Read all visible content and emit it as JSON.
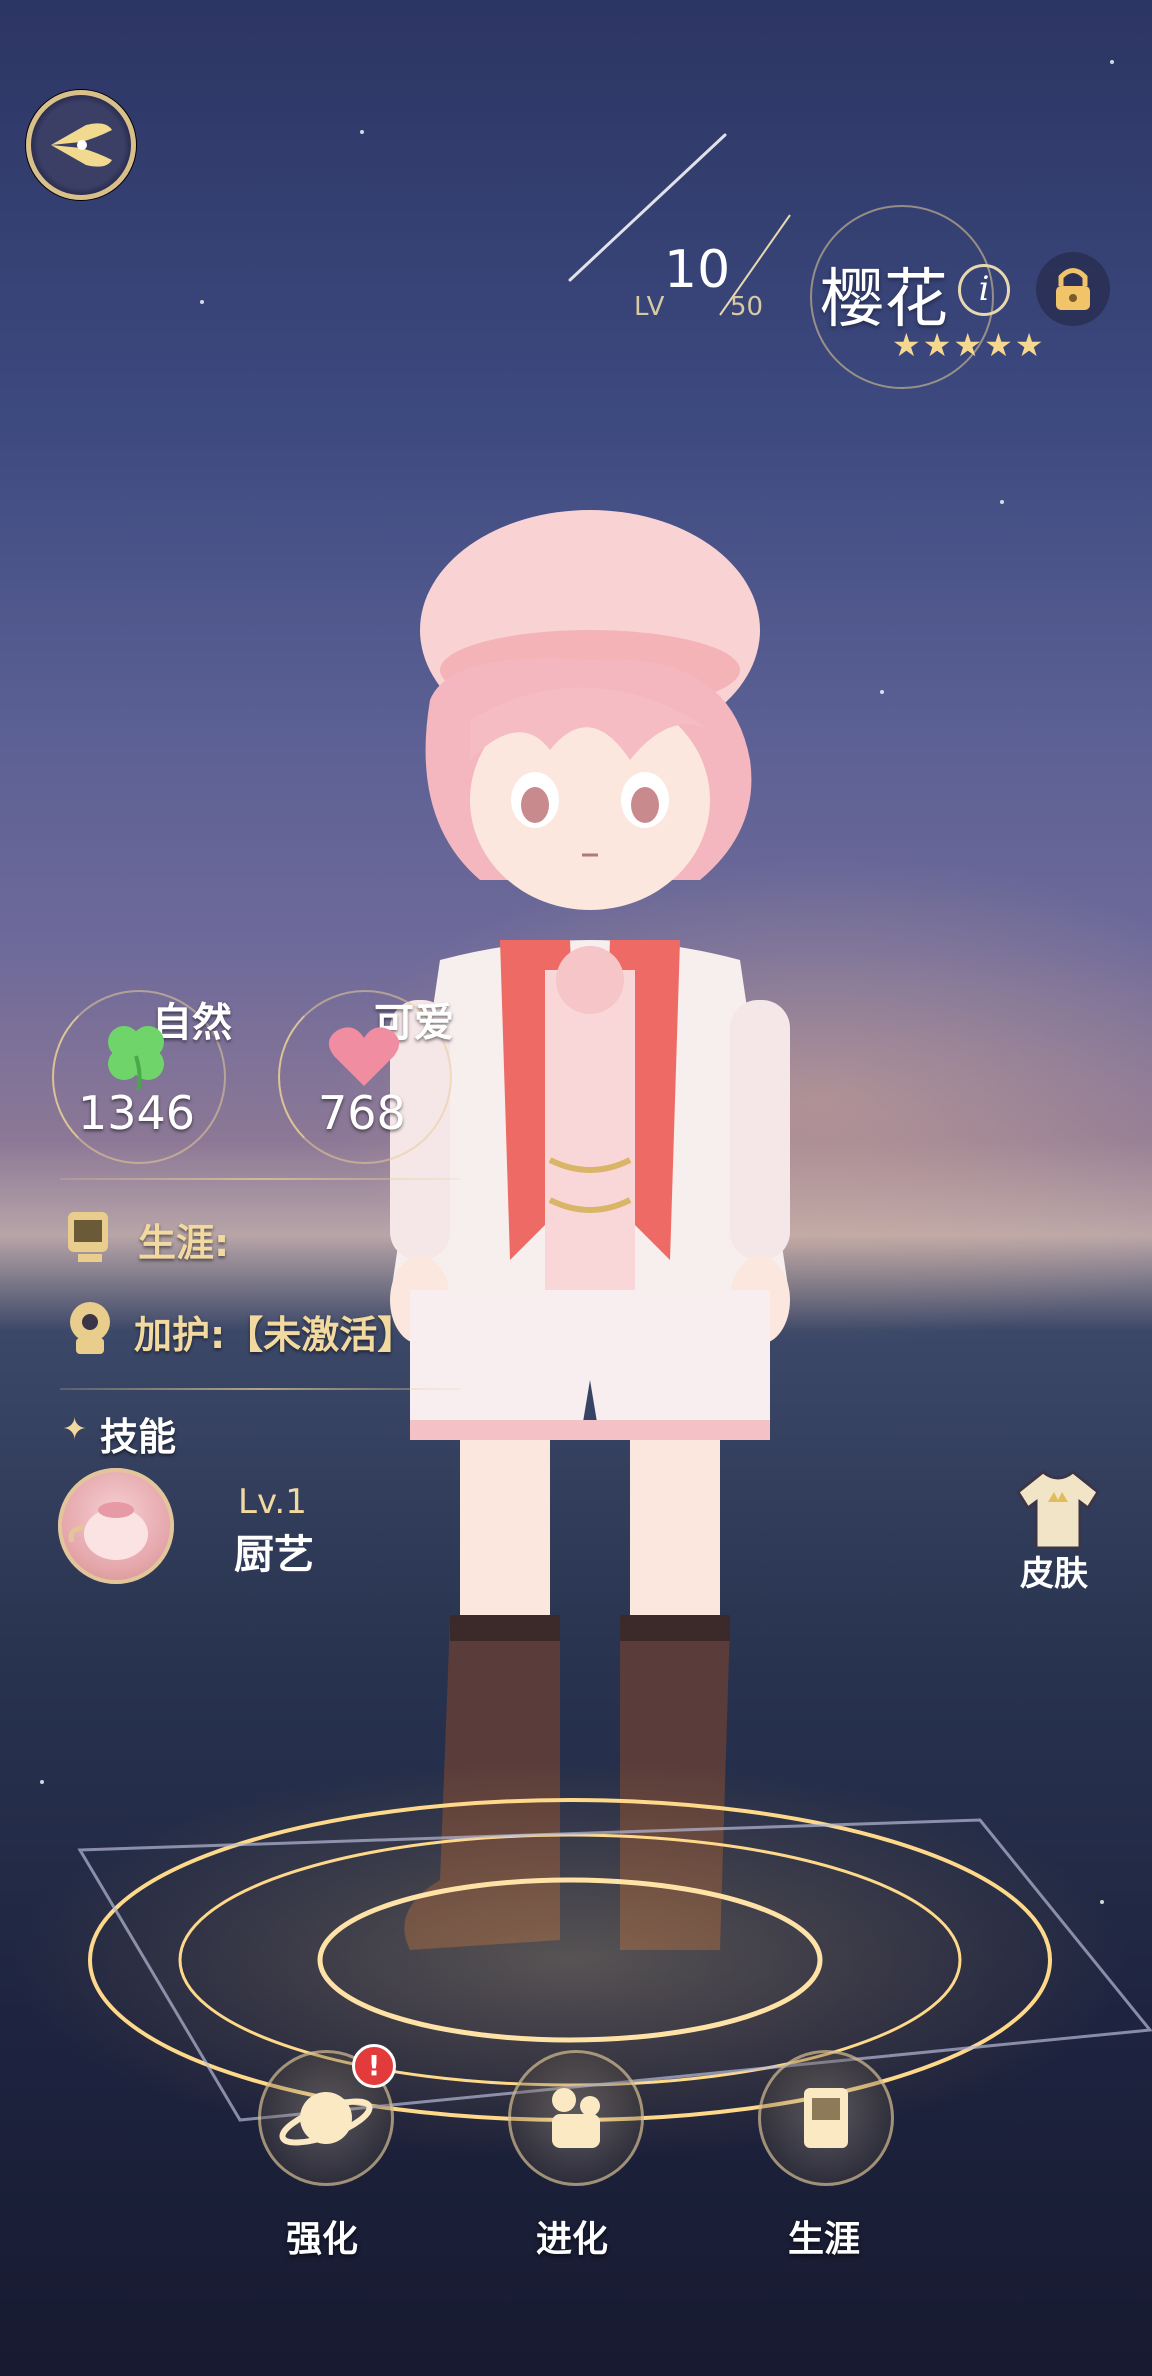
{
  "header": {
    "level_label": "LV",
    "level": "10",
    "level_max": "50",
    "name": "樱花",
    "info_glyph": "i",
    "stars": "★★★★★",
    "star_count": 5
  },
  "attributes": [
    {
      "label": "自然",
      "value": "1346",
      "icon": "clover-icon"
    },
    {
      "label": "可爱",
      "value": "768",
      "icon": "heart-icon"
    }
  ],
  "rows": {
    "career_label": "生涯:",
    "protect_label": "加护:【未激活】"
  },
  "skill": {
    "section_label": "技能",
    "level": "Lv.1",
    "name": "厨艺"
  },
  "skin": {
    "label": "皮肤"
  },
  "bottom_nav": [
    {
      "label": "强化",
      "icon": "saturn-icon",
      "alert": "!"
    },
    {
      "label": "进化",
      "icon": "figure-icon"
    },
    {
      "label": "生涯",
      "icon": "card-icon"
    }
  ],
  "colors": {
    "accent_gold": "#f2d9a0",
    "clover_green": "#6fd46a",
    "heart_pink": "#f08da0",
    "alert_red": "#e33b3b"
  }
}
